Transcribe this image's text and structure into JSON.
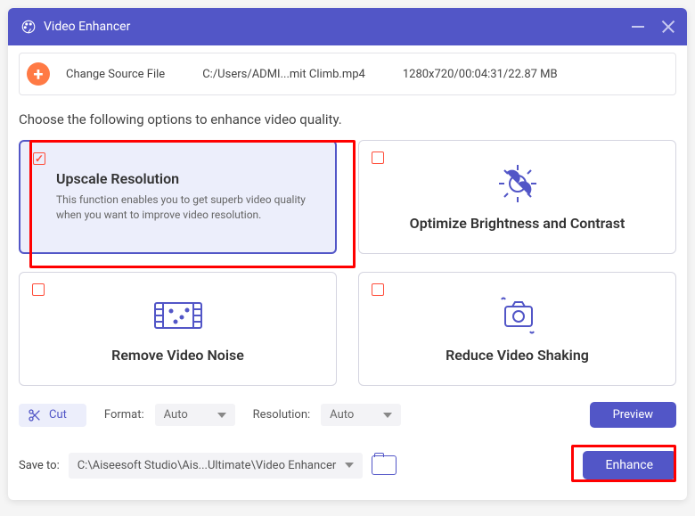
{
  "titlebar": {
    "title": "Video Enhancer"
  },
  "source": {
    "change_label": "Change Source File",
    "path": "C:/Users/ADMI...mit Climb.mp4",
    "meta": "1280x720/00:04:31/22.87 MB"
  },
  "instruction": "Choose the following options to enhance video quality.",
  "cards": {
    "upscale": {
      "title": "Upscale Resolution",
      "desc": "This function enables you to get superb video quality when you want to improve video resolution."
    },
    "brightness": {
      "title": "Optimize Brightness and Contrast"
    },
    "noise": {
      "title": "Remove Video Noise"
    },
    "shaking": {
      "title": "Reduce Video Shaking"
    }
  },
  "toolbar": {
    "cut_label": "Cut",
    "format_label": "Format:",
    "format_value": "Auto",
    "resolution_label": "Resolution:",
    "resolution_value": "Auto",
    "preview_label": "Preview"
  },
  "save": {
    "label": "Save to:",
    "path": "C:\\Aiseesoft Studio\\Ais...Ultimate\\Video Enhancer",
    "enhance_label": "Enhance"
  }
}
